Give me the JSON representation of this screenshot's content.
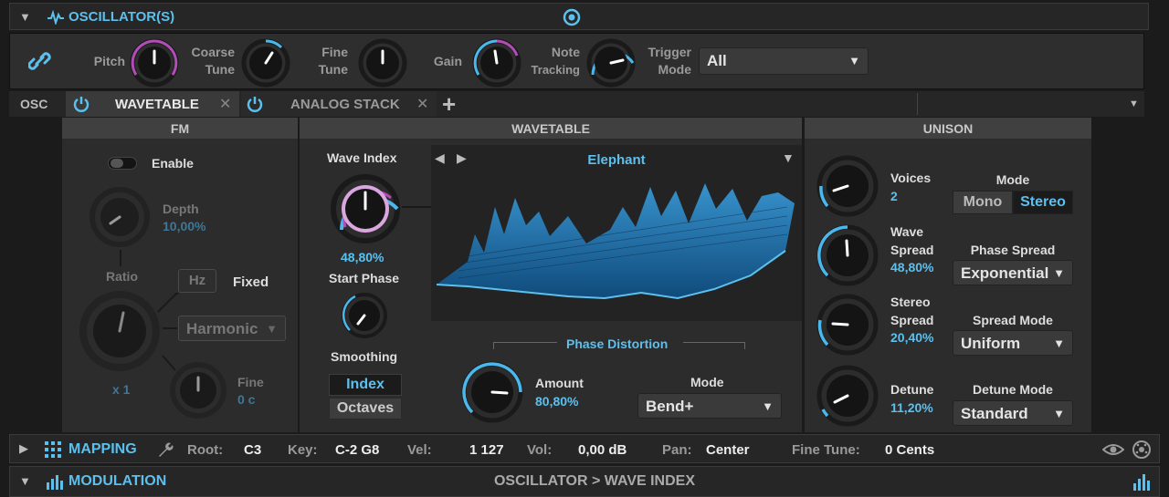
{
  "colors": {
    "accent": "#4ab8ec",
    "panel": "#2c2c2c",
    "pink": "#b24db7"
  },
  "osc_header": {
    "title": "OSCILLATOR(S)",
    "collapse_icon": "triangle-down-icon",
    "waveform_icon": "waveform-icon",
    "target_icon": "target-icon"
  },
  "knobs_row": {
    "link_icon": "link-icon",
    "pitch": "Pitch",
    "coarse": [
      "Coarse",
      "Tune"
    ],
    "fine": [
      "Fine",
      "Tune"
    ],
    "gain": "Gain",
    "note": [
      "Note",
      "Tracking"
    ],
    "trigger": [
      "Trigger",
      "Mode"
    ],
    "trigger_value": "All"
  },
  "tabs": {
    "osc": "OSC",
    "tab1": "WAVETABLE",
    "tab2": "ANALOG STACK",
    "add": "+",
    "close": "✕"
  },
  "fm": {
    "title": "FM",
    "enable": "Enable",
    "depth_label": "Depth",
    "depth_value": "10,00%",
    "ratio": "Ratio",
    "hz": "Hz",
    "fixed": "Fixed",
    "harmonic": "Harmonic",
    "multiplier": "x 1",
    "fine_label": "Fine",
    "fine_value": "0 c"
  },
  "wavetable": {
    "title": "WAVETABLE",
    "wave_index": "Wave Index",
    "wave_index_value": "48,80%",
    "start_phase": "Start Phase",
    "smoothing": "Smoothing",
    "index": "Index",
    "octaves": "Octaves",
    "table_name": "Elephant",
    "phase_distortion": "Phase Distortion",
    "amount_label": "Amount",
    "amount_value": "80,80%",
    "mode_label": "Mode",
    "mode_value": "Bend+"
  },
  "unison": {
    "title": "UNISON",
    "voices_label": "Voices",
    "voices_value": "2",
    "wave_spread_label": [
      "Wave",
      "Spread"
    ],
    "wave_spread_value": "48,80%",
    "stereo_spread_label": [
      "Stereo",
      "Spread"
    ],
    "stereo_spread_value": "20,40%",
    "detune_label": "Detune",
    "detune_value": "11,20%",
    "mode_label": "Mode",
    "mono": "Mono",
    "stereo": "Stereo",
    "phase_spread_label": "Phase Spread",
    "phase_spread_value": "Exponential",
    "spread_mode_label": "Spread Mode",
    "spread_mode_value": "Uniform",
    "detune_mode_label": "Detune Mode",
    "detune_mode_value": "Standard"
  },
  "mapping": {
    "title": "MAPPING",
    "root_label": "Root:",
    "root": "C3",
    "key_label": "Key:",
    "key": "C-2 G8",
    "vel_label": "Vel:",
    "vel": "1 127",
    "vol_label": "Vol:",
    "vol": "0,00 dB",
    "pan_label": "Pan:",
    "pan": "Center",
    "finetune_label": "Fine Tune:",
    "finetune": "0 Cents"
  },
  "modulation": {
    "title": "MODULATION",
    "path": "OSCILLATOR > WAVE INDEX"
  }
}
